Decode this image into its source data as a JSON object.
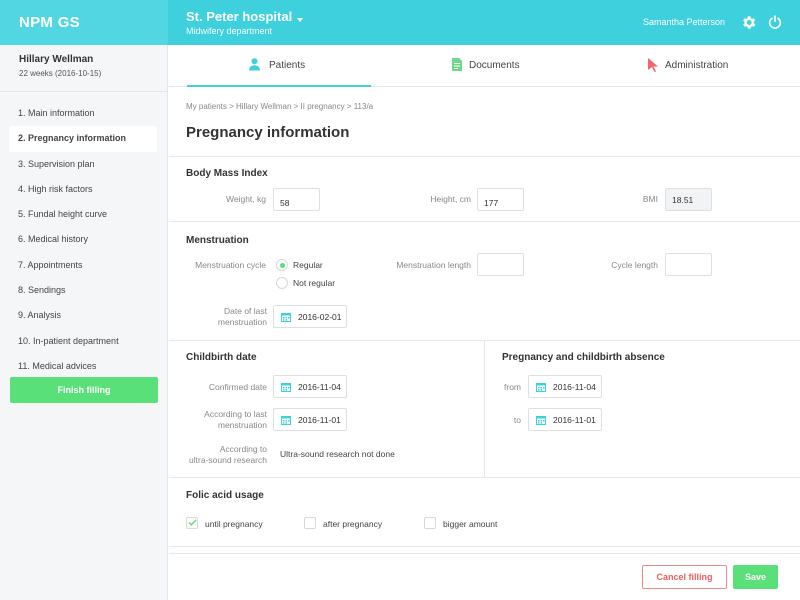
{
  "app": {
    "brand": "NPM GS"
  },
  "header": {
    "hospital_name": "St. Peter hospital",
    "department": "Midwifery department",
    "user_name": "Samantha Petterson",
    "icons": [
      "chevron-down-icon",
      "gear-icon",
      "power-icon"
    ]
  },
  "patient": {
    "name": "Hillary Wellman",
    "weeks": "22 weeks (2016-10-15)"
  },
  "sidebar": {
    "items": [
      {
        "label": "1. Main information"
      },
      {
        "label": "2. Pregnancy information",
        "active": true
      },
      {
        "label": "3. Supervision plan"
      },
      {
        "label": "4. High risk factors"
      },
      {
        "label": "5. Fundal height curve"
      },
      {
        "label": "6. Medical history"
      },
      {
        "label": "7. Appointments"
      },
      {
        "label": "8. Sendings"
      },
      {
        "label": "9. Analysis"
      },
      {
        "label": "10. In-patient department"
      },
      {
        "label": "11. Medical advices"
      }
    ],
    "finish_label": "Finish filling"
  },
  "tabs": [
    {
      "label": "Patients",
      "icon": "person-icon",
      "active": true
    },
    {
      "label": "Documents",
      "icon": "document-icon"
    },
    {
      "label": "Administration",
      "icon": "cursor-icon"
    }
  ],
  "breadcrumb": "My patients > Hillary Wellman > II pregnancy > 113/a",
  "page_title": "Pregnancy information",
  "bmi": {
    "title": "Body Mass Index",
    "weight_label": "Weight, kg",
    "weight_value": "58",
    "height_label": "Height, cm",
    "height_value": "177",
    "bmi_label": "BMI",
    "bmi_value": "18.51"
  },
  "menstruation": {
    "title": "Menstruation",
    "cycle_label": "Menstruation cycle",
    "option_regular": "Regular",
    "option_not_regular": "Not regular",
    "selected": "Regular",
    "length_label": "Menstruation length",
    "length_value": "",
    "cycle_length_label": "Cycle length",
    "cycle_length_value": "",
    "last_label_line1": "Date of last",
    "last_label_line2": "menstruation",
    "last_date": "2016-02-01"
  },
  "childbirth": {
    "title": "Childbirth date",
    "confirmed_label": "Confirmed date",
    "confirmed_date": "2016-11-04",
    "according_last_line1": "According to last",
    "according_last_line2": "menstruation",
    "according_last_date": "2016-11-01",
    "according_ultra_line1": "According to",
    "according_ultra_line2": "ultra-sound research",
    "according_ultra_value": "Ultra-sound research not done"
  },
  "absence": {
    "title": "Pregnancy and childbirth absence",
    "from_label": "from",
    "from_date": "2016-11-04",
    "to_label": "to",
    "to_date": "2016-11-01"
  },
  "folic": {
    "title": "Folic acid usage",
    "options": [
      {
        "label": "until pregnancy",
        "checked": true
      },
      {
        "label": "after pregnancy",
        "checked": false
      },
      {
        "label": "bigger amount",
        "checked": false
      }
    ]
  },
  "footer": {
    "cancel_label": "Cancel filling",
    "save_label": "Save"
  },
  "colors": {
    "accent": "#3fd0dd",
    "success": "#59e079",
    "danger": "#e86060"
  }
}
